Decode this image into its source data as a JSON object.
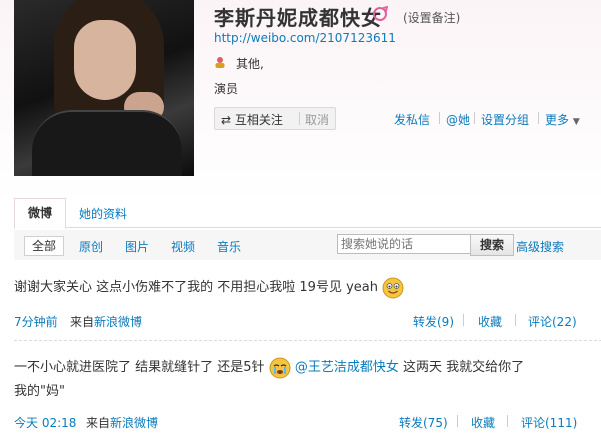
{
  "profile": {
    "name": "李斯丹妮成都快女",
    "remark_label": "(设置备注)",
    "url": "http://weibo.com/2107123611",
    "location": "其他,",
    "occupation": "演员",
    "follow_label": "互相关注",
    "cancel_label": "取消",
    "actions": [
      "发私信",
      "@她",
      "设置分组",
      "更多"
    ]
  },
  "tabs": [
    "微博",
    "她的资料"
  ],
  "filters": {
    "all": "全部",
    "items": [
      "原创",
      "图片",
      "视频",
      "音乐"
    ],
    "search_placeholder": "搜索她说的话",
    "search_button": "搜索",
    "advanced_search": "高级搜索"
  },
  "posts": [
    {
      "text": "谢谢大家关心 这点小伤难不了我的 不用担心我啦 19号见 yeah",
      "time": "7分钟前",
      "from_label": "来自",
      "source": "新浪微博",
      "repost": "转发(9)",
      "favorite": "收藏",
      "comment": "评论(22)"
    },
    {
      "text_part1": "一不小心就进医院了 结果就缝针了 还是5针",
      "mention": "@王艺洁成都快女",
      "text_part2": "这两天 我就交给你了",
      "text_line2": "我的\"妈\"",
      "time": "今天 02:18",
      "from_label": "来自",
      "source": "新浪微博",
      "repost": "转发(75)",
      "favorite": "收藏",
      "comment": "评论(111)"
    }
  ],
  "colors": {
    "link": "#0a7bbd",
    "text": "#333333"
  }
}
